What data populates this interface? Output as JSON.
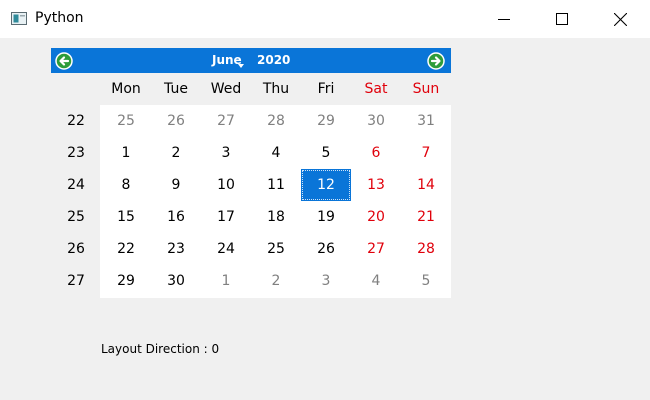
{
  "window": {
    "title": "Python",
    "icon": "app-window-icon",
    "controls": [
      "minimize-icon",
      "maximize-icon",
      "close-icon"
    ]
  },
  "calendar": {
    "month": "June",
    "year": "2020",
    "prev_icon": "prev-month-arrow-icon",
    "next_icon": "next-month-arrow-icon",
    "header_color": "#0a75d8",
    "weekend_color": "#e0000b",
    "days_of_week": [
      "Mon",
      "Tue",
      "Wed",
      "Thu",
      "Fri",
      "Sat",
      "Sun"
    ],
    "week_numbers": [
      "22",
      "23",
      "24",
      "25",
      "26",
      "27"
    ],
    "weeks": [
      [
        "25",
        "26",
        "27",
        "28",
        "29",
        "30",
        "31"
      ],
      [
        "1",
        "2",
        "3",
        "4",
        "5",
        "6",
        "7"
      ],
      [
        "8",
        "9",
        "10",
        "11",
        "12",
        "13",
        "14"
      ],
      [
        "15",
        "16",
        "17",
        "18",
        "19",
        "20",
        "21"
      ],
      [
        "22",
        "23",
        "24",
        "25",
        "26",
        "27",
        "28"
      ],
      [
        "29",
        "30",
        "1",
        "2",
        "3",
        "4",
        "5"
      ]
    ],
    "selected_date": "12"
  },
  "footer": {
    "label": "Layout Direction : 0"
  }
}
